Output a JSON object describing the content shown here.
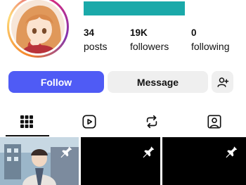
{
  "profile": {
    "avatar_icon": "anime-avatar",
    "ring_colors": [
      "#f58529",
      "#feda77",
      "#dd2a7b",
      "#8134af"
    ],
    "username_redaction_color": "#1aa9a9"
  },
  "stats": {
    "posts": {
      "count": "34",
      "label": "posts"
    },
    "followers": {
      "count": "19K",
      "label": "followers"
    },
    "following": {
      "count": "0",
      "label": "following"
    }
  },
  "actions": {
    "follow_label": "Follow",
    "message_label": "Message",
    "add_user_icon": "person-add-icon",
    "follow_color": "#4f5bf5"
  },
  "tabs": [
    {
      "icon": "grid-icon",
      "selected": true
    },
    {
      "icon": "reels-play-icon",
      "selected": false
    },
    {
      "icon": "repost-icon",
      "selected": false
    },
    {
      "icon": "tagged-person-icon",
      "selected": false
    }
  ],
  "posts": [
    {
      "kind": "anime-still",
      "pinned": true
    },
    {
      "kind": "black",
      "pinned": true
    },
    {
      "kind": "black",
      "pinned": true
    }
  ]
}
